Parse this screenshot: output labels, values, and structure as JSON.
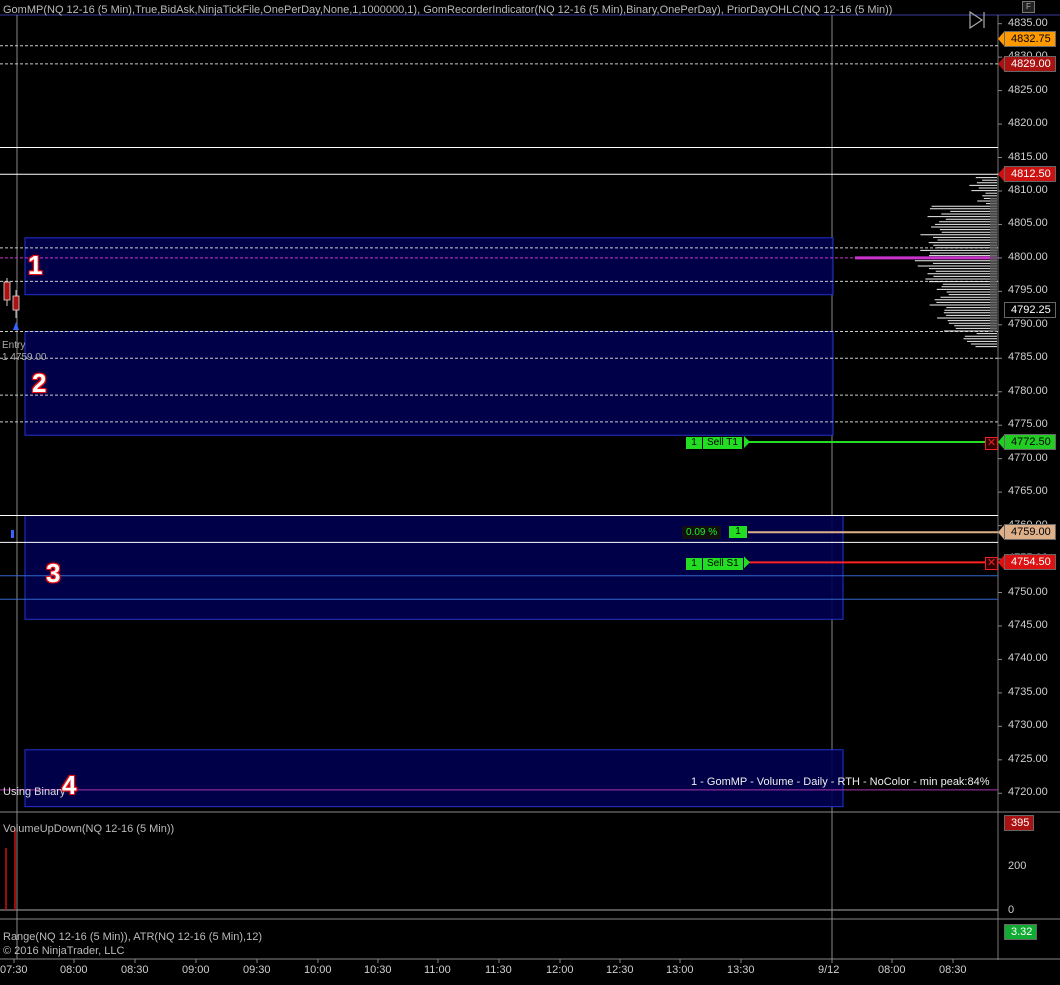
{
  "panel_titles": {
    "price": "GomMP(NQ 12-16 (5 Min),True,BidAsk,NinjaTickFile,OnePerDay,None,1,1000000,1), GomRecorderIndicator(NQ 12-16 (5 Min),Binary,OnePerDay), PriorDayOHLC(NQ 12-16 (5 Min))",
    "volume": "VolumeUpDown(NQ 12-16 (5 Min))",
    "range": "Range(NQ 12-16 (5 Min)), ATR(NQ 12-16 (5 Min),12)"
  },
  "copyright": "© 2016 NinjaTrader, LLC",
  "using_binary": "Using Binary",
  "gommp_info": "1 - GomMP - Volume - Daily - RTH - NoColor - min peak:84%",
  "entry_marker": {
    "label": "Entry",
    "price": "1 4759.00"
  },
  "zones": [
    {
      "number": "1",
      "top": 4803.0,
      "bottom": 4794.5
    },
    {
      "number": "2",
      "top": 4789.0,
      "bottom": 4773.5
    },
    {
      "number": "3",
      "top": 4761.5,
      "bottom": 4746.0
    },
    {
      "number": "4",
      "top": 4726.5,
      "bottom": 4718.0
    }
  ],
  "y_axis": {
    "ticks": [
      "4835.00",
      "4830.00",
      "4825.00",
      "4820.00",
      "4815.00",
      "4810.00",
      "4805.00",
      "4800.00",
      "4795.00",
      "4790.00",
      "4785.00",
      "4780.00",
      "4775.00",
      "4770.00",
      "4765.00",
      "4760.00",
      "4755.00",
      "4750.00",
      "4745.00",
      "4740.00",
      "4735.00",
      "4730.00",
      "4725.00",
      "4720.00"
    ],
    "range": [
      4717.5,
      4836.0
    ]
  },
  "price_tags": [
    {
      "value": "4832.75",
      "color": "#ff9900",
      "text_color": "#000000"
    },
    {
      "value": "4829.00",
      "color": "#aa1111",
      "text_color": "#ffffff"
    },
    {
      "value": "4812.50",
      "color": "#cc1111",
      "text_color": "#ffffff"
    },
    {
      "value": "4792.25",
      "color": "#000000",
      "text_color": "#ffffff"
    },
    {
      "value": "4772.50",
      "color": "#22cc22",
      "text_color": "#000000"
    },
    {
      "value": "4759.00",
      "color": "#ddb08a",
      "text_color": "#000000"
    },
    {
      "value": "4754.50",
      "color": "#dd1111",
      "text_color": "#ffffff"
    }
  ],
  "orders": {
    "target": {
      "qty": "1",
      "label": "Sell T1",
      "price": 4772.5
    },
    "stop": {
      "qty": "1",
      "label": "Sell S1",
      "price": 4754.5
    },
    "position": {
      "pnl": "0.09 %",
      "qty": "1",
      "price": 4759.0
    }
  },
  "horizontal_lines": [
    {
      "price": 4829.0,
      "color": "#cccccc",
      "style": "dashed"
    },
    {
      "price": 4831.7,
      "color": "#cccccc",
      "style": "dashed"
    },
    {
      "price": 4816.5,
      "color": "#ffffff",
      "style": "solid"
    },
    {
      "price": 4812.5,
      "color": "#ffffff",
      "style": "solid"
    },
    {
      "price": 4801.5,
      "color": "#cccccc",
      "style": "dashed"
    },
    {
      "price": 4800.0,
      "color": "#cc33cc",
      "style": "dashed"
    },
    {
      "price": 4796.5,
      "color": "#cccccc",
      "style": "dashed"
    },
    {
      "price": 4789.0,
      "color": "#cccccc",
      "style": "dashed"
    },
    {
      "price": 4785.0,
      "color": "#cccccc",
      "style": "dashed"
    },
    {
      "price": 4779.5,
      "color": "#cccccc",
      "style": "dashed"
    },
    {
      "price": 4775.5,
      "color": "#cccccc",
      "style": "dashed"
    },
    {
      "price": 4761.5,
      "color": "#ffffff",
      "style": "solid"
    },
    {
      "price": 4757.5,
      "color": "#ffffff",
      "style": "solid"
    },
    {
      "price": 4752.5,
      "color": "#3366cc",
      "style": "solid"
    },
    {
      "price": 4749.0,
      "color": "#3366cc",
      "style": "solid"
    },
    {
      "price": 4720.5,
      "color": "#aa33aa",
      "style": "solid"
    }
  ],
  "volume_panel": {
    "ticks": [
      "200",
      "0"
    ],
    "current_tag": "395",
    "range": [
      0,
      395
    ]
  },
  "range_panel": {
    "current_tag": "3.32"
  },
  "x_axis": {
    "ticks": [
      "07:30",
      "08:00",
      "08:30",
      "09:00",
      "09:30",
      "10:00",
      "10:30",
      "11:00",
      "11:30",
      "12:00",
      "12:30",
      "13:00",
      "13:30",
      "9/12",
      "08:00",
      "08:30"
    ]
  },
  "colors": {
    "zone_fill": "#000050",
    "zone_border": "#2233cc",
    "target_line": "#22dd22",
    "stop_line": "#ff2222",
    "position_line": "#ddb08a",
    "profile_poc": "#cc33cc"
  }
}
